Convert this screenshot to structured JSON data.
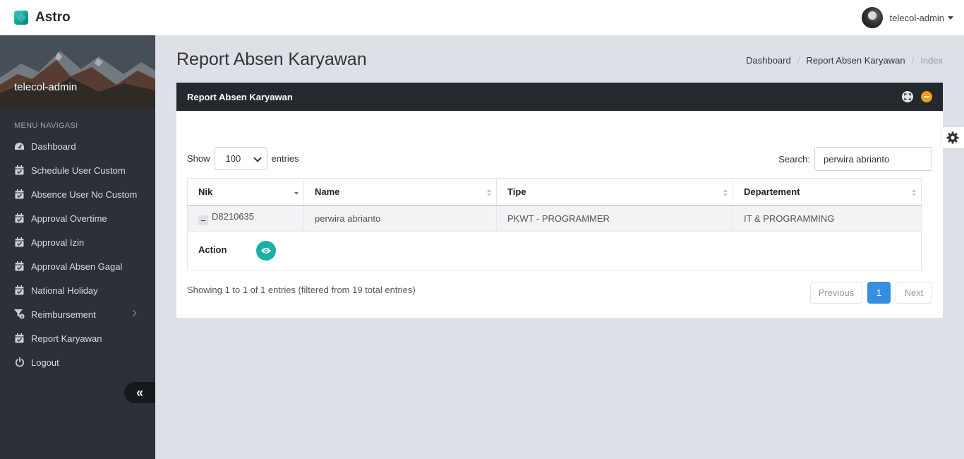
{
  "app": {
    "name": "Astro"
  },
  "user": {
    "name": "telecol-admin"
  },
  "sidebar": {
    "username": "telecol-admin",
    "menu_title": "MENU NAVIGASI",
    "items": [
      {
        "label": "Dashboard",
        "icon": "dashboard-icon"
      },
      {
        "label": "Schedule User Custom",
        "icon": "calendar-check-icon"
      },
      {
        "label": "Absence User No Custom",
        "icon": "calendar-check-icon"
      },
      {
        "label": "Approval Overtime",
        "icon": "calendar-check-icon"
      },
      {
        "label": "Approval Izin",
        "icon": "calendar-check-icon"
      },
      {
        "label": "Approval Absen Gagal",
        "icon": "calendar-check-icon"
      },
      {
        "label": "National Holiday",
        "icon": "calendar-check-icon"
      },
      {
        "label": "Reimbursement",
        "icon": "filter-money-icon"
      },
      {
        "label": "Report Karyawan",
        "icon": "calendar-check-icon"
      },
      {
        "label": "Logout",
        "icon": "power-icon"
      }
    ],
    "collapse_label": "«"
  },
  "page": {
    "title": "Report Absen Karyawan",
    "breadcrumb": [
      "Dashboard",
      "Report Absen Karyawan",
      "Index"
    ]
  },
  "panel": {
    "title": "Report Absen Karyawan",
    "length": {
      "show": "Show",
      "value": "100",
      "entries": "entries"
    },
    "search": {
      "label": "Search:",
      "value": "perwira abrianto"
    },
    "table": {
      "headers": [
        "Nik",
        "Name",
        "Tipe",
        "Departement"
      ],
      "rows": [
        {
          "nik": "D8210635",
          "name": "perwira abrianto",
          "tipe": "PKWT - PROGRAMMER",
          "departement": "IT & PROGRAMMING"
        }
      ],
      "child_label": "Action"
    },
    "info": "Showing 1 to 1 of 1 entries (filtered from 19 total entries)",
    "pagination": {
      "previous": "Previous",
      "page": "1",
      "next": "Next"
    }
  },
  "colors": {
    "accent": "#348fe2",
    "teal": "#1ab1a4",
    "warning": "#f59c1a",
    "sidebar": "#2b3136",
    "panel_header": "#24292e"
  }
}
